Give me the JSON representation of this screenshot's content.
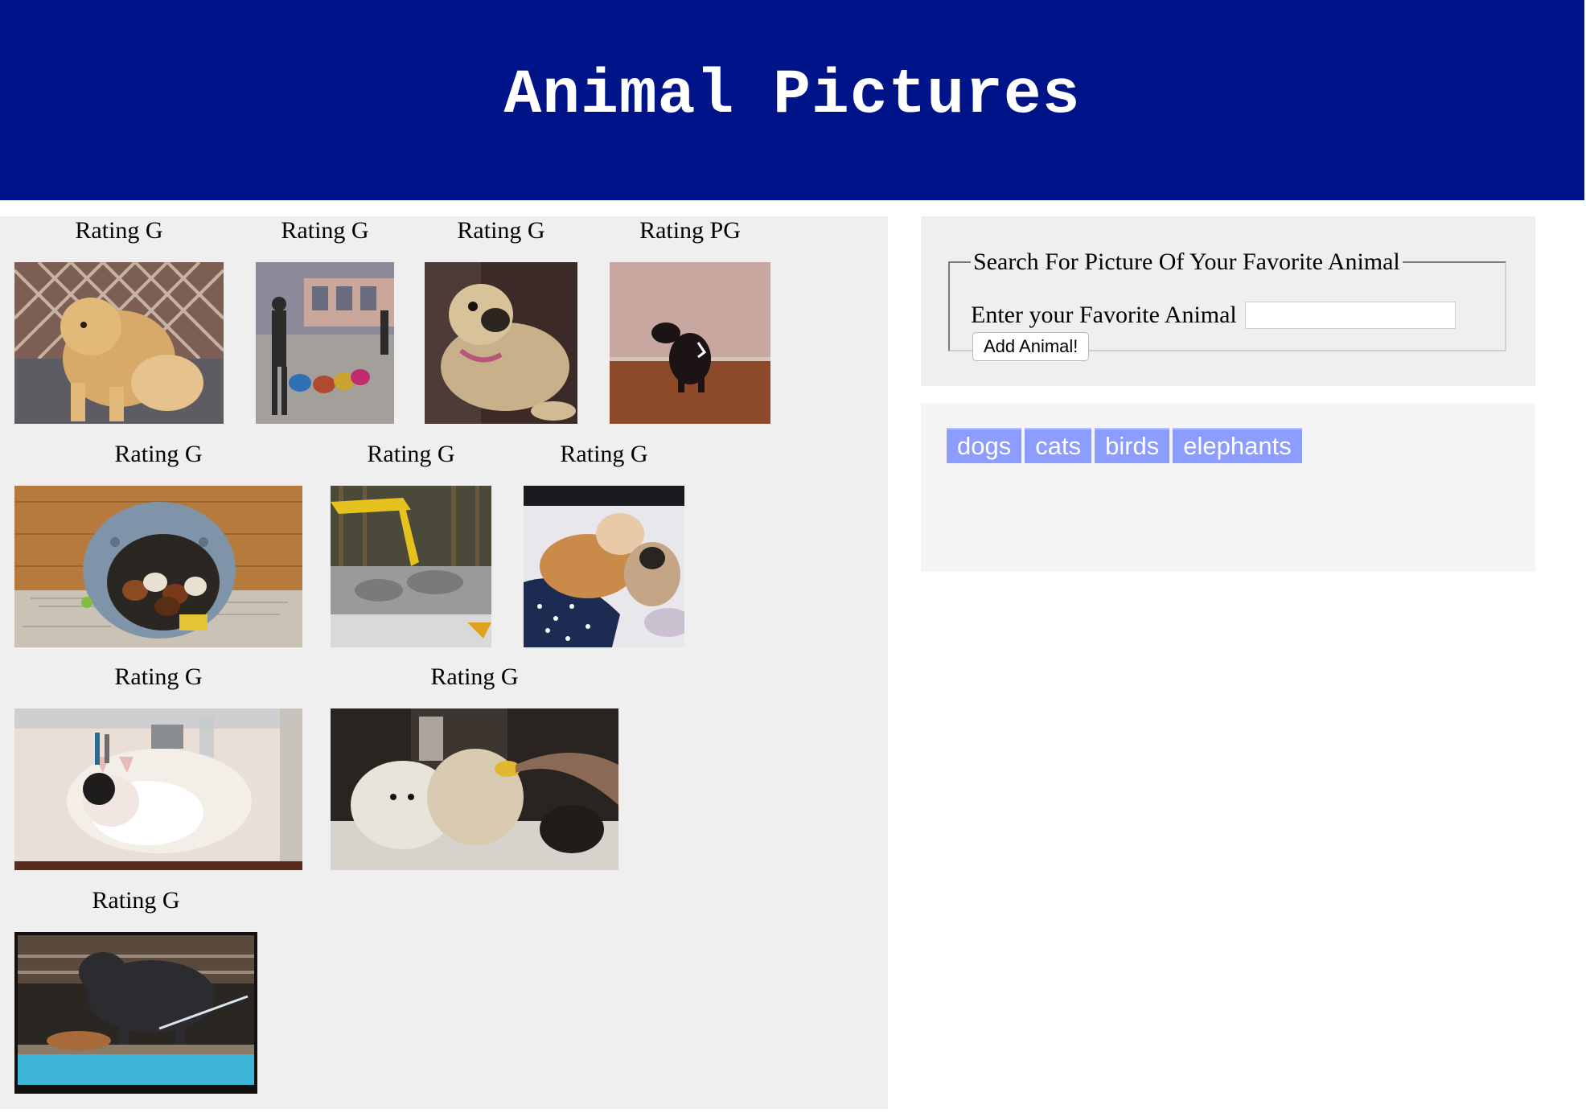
{
  "header": {
    "title": "Animal Pictures"
  },
  "gallery": {
    "gifs": [
      {
        "rating": "Rating G",
        "subject": "golden-retriever"
      },
      {
        "rating": "Rating G",
        "subject": "dogs-on-leashes"
      },
      {
        "rating": "Rating G",
        "subject": "pug-on-couch"
      },
      {
        "rating": "Rating PG",
        "subject": "small-black-dog"
      },
      {
        "rating": "Rating G",
        "subject": "puppies-in-bed"
      },
      {
        "rating": "Rating G",
        "subject": "excavator-woods"
      },
      {
        "rating": "Rating G",
        "subject": "bulldog-and-pug"
      },
      {
        "rating": "Rating G",
        "subject": "bulldog-in-sink"
      },
      {
        "rating": "Rating G",
        "subject": "dogs-in-bath"
      },
      {
        "rating": "Rating G",
        "subject": "dogs-by-pool"
      }
    ]
  },
  "search_form": {
    "legend": "Search For Picture Of Your Favorite Animal",
    "field_label": "Enter your Favorite Animal",
    "input_value": "",
    "submit_label": "Add Animal!"
  },
  "animal_buttons": [
    "dogs",
    "cats",
    "birds",
    "elephants"
  ],
  "colors": {
    "header_bg": "#001489",
    "panel_bg": "#efefef",
    "button_bg": "#8c9cff"
  }
}
